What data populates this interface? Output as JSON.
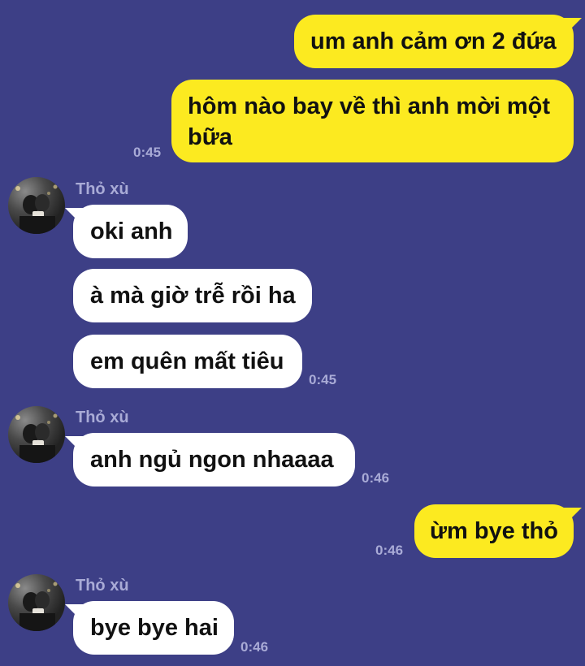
{
  "colors": {
    "background": "#3d3f86",
    "outgoing_bubble": "#fcea20",
    "incoming_bubble": "#ffffff",
    "timestamp": "#a9abd6"
  },
  "messages": {
    "m1": {
      "text": "um anh cảm ơn 2 đứa"
    },
    "m2": {
      "text_line1": "hôm nào bay về thì anh mời một",
      "text_line2": "bữa",
      "time": "0:45"
    },
    "g1": {
      "sender": "Thỏ xù",
      "avatar_icon": "profile-photo",
      "m1": "oki anh",
      "m2": "à mà giờ trễ rồi ha",
      "m3": "em quên mất tiêu",
      "time": "0:45"
    },
    "g2": {
      "sender": "Thỏ xù",
      "avatar_icon": "profile-photo",
      "m1": "anh ngủ ngon nhaaaa",
      "time": "0:46"
    },
    "m3": {
      "text": "ừm bye thỏ",
      "time": "0:46"
    },
    "g3": {
      "sender": "Thỏ xù",
      "avatar_icon": "profile-photo",
      "m1": "bye bye hai",
      "time": "0:46"
    }
  }
}
